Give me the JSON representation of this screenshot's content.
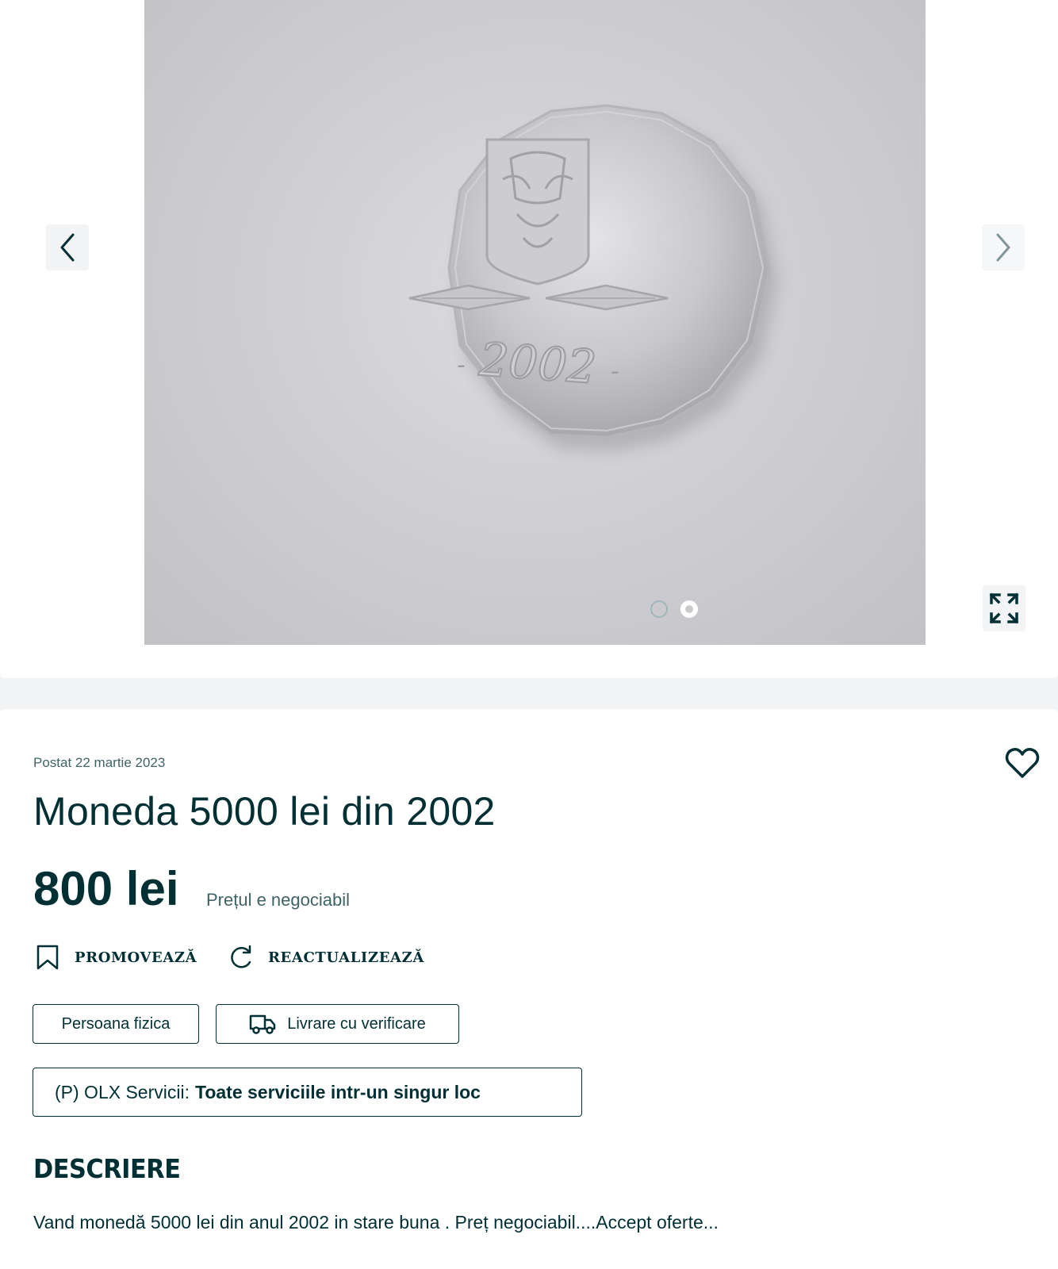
{
  "gallery": {
    "coin_year": "2002",
    "image_count": 2,
    "active_image": 2,
    "prev_icon": "chevron-left-icon",
    "next_icon": "chevron-right-icon",
    "expand_icon": "expand-icon"
  },
  "listing": {
    "posted": "Postat 22 martie 2023",
    "title": "Moneda 5000 lei din 2002",
    "price": "800 lei",
    "negotiable": "Prețul e negociabil",
    "favorite_icon": "heart-icon"
  },
  "actions": {
    "promote": "PROMOVEAZĂ",
    "refresh": "REACTUALIZEAZĂ"
  },
  "tags": {
    "seller_type": "Persoana fizica",
    "delivery": "Livrare cu verificare"
  },
  "promo": {
    "prefix": "(P) OLX Servicii:",
    "text": "Toate serviciile intr-un singur loc"
  },
  "description": {
    "heading": "DESCRIERE",
    "text": "Vand monedă 5000 lei din anul 2002 in stare buna . Preț negociabil....Accept oferte..."
  },
  "colors": {
    "primary": "#002f34",
    "muted": "#406367",
    "background": "#f2f4f5"
  }
}
